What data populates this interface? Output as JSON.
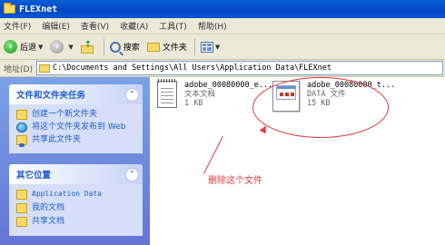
{
  "window": {
    "title": "FLEXnet"
  },
  "menu": [
    "文件(F)",
    "编辑(E)",
    "查看(V)",
    "收藏(A)",
    "工具(T)",
    "帮助(H)"
  ],
  "toolbar": {
    "back": "后退",
    "search": "搜索",
    "folders": "文件夹"
  },
  "address": {
    "label": "地址(D)",
    "path": "C:\\Documents and Settings\\All Users\\Application Data\\FLEXnet"
  },
  "tasks_panel": {
    "title": "文件和文件夹任务",
    "items": [
      "创建一个新文件夹",
      "将这个文件夹发布到 Web",
      "共享此文件夹"
    ]
  },
  "other_panel": {
    "title": "其它位置",
    "items": [
      "Application Data",
      "我的文档",
      "共享文档"
    ]
  },
  "files": [
    {
      "name": "adobe_00080000_e...",
      "type": "文本文档",
      "size": "1 KB"
    },
    {
      "name": "adobe_00080000_t...",
      "type": "DATA 文件",
      "size": "15 KB"
    }
  ],
  "annotation": "删除这个文件",
  "colors": {
    "annotation": "#e23b3b",
    "taskpane_link": "#215dc6",
    "titlebar": "#0347c4"
  }
}
